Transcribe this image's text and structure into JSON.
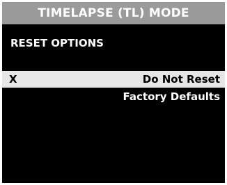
{
  "header": {
    "title": "TIMELAPSE (TL) MODE"
  },
  "section": {
    "title": "RESET OPTIONS"
  },
  "options": [
    {
      "marker": "X",
      "label": "Do Not Reset"
    },
    {
      "marker": "",
      "label": "Factory Defaults"
    }
  ],
  "colors": {
    "background": "#000000",
    "title_bar": "#9a9a9a",
    "selected_row": "#e6e6e6",
    "text": "#ffffff",
    "selected_text": "#000000"
  }
}
